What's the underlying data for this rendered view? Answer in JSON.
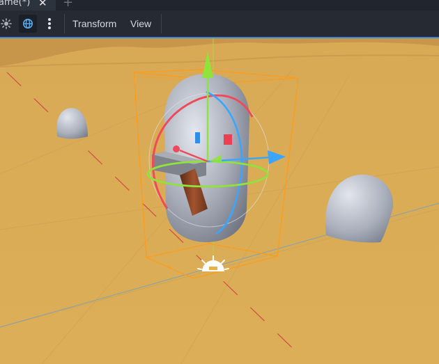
{
  "tabs": [
    {
      "label": "ame(*)",
      "close_icon": "close-icon"
    }
  ],
  "toolbar": {
    "sun_icon": "sun-icon",
    "globe_icon": "globe-icon",
    "more_icon": "kebab-menu-icon",
    "menus": [
      "Transform",
      "View"
    ]
  },
  "viewport": {
    "gizmo_colors": {
      "x": "#ee4a5b",
      "y": "#90e33b",
      "z": "#3aa6ff",
      "selection": "#ff9b1a"
    },
    "ground_color": "#d9ab55"
  }
}
